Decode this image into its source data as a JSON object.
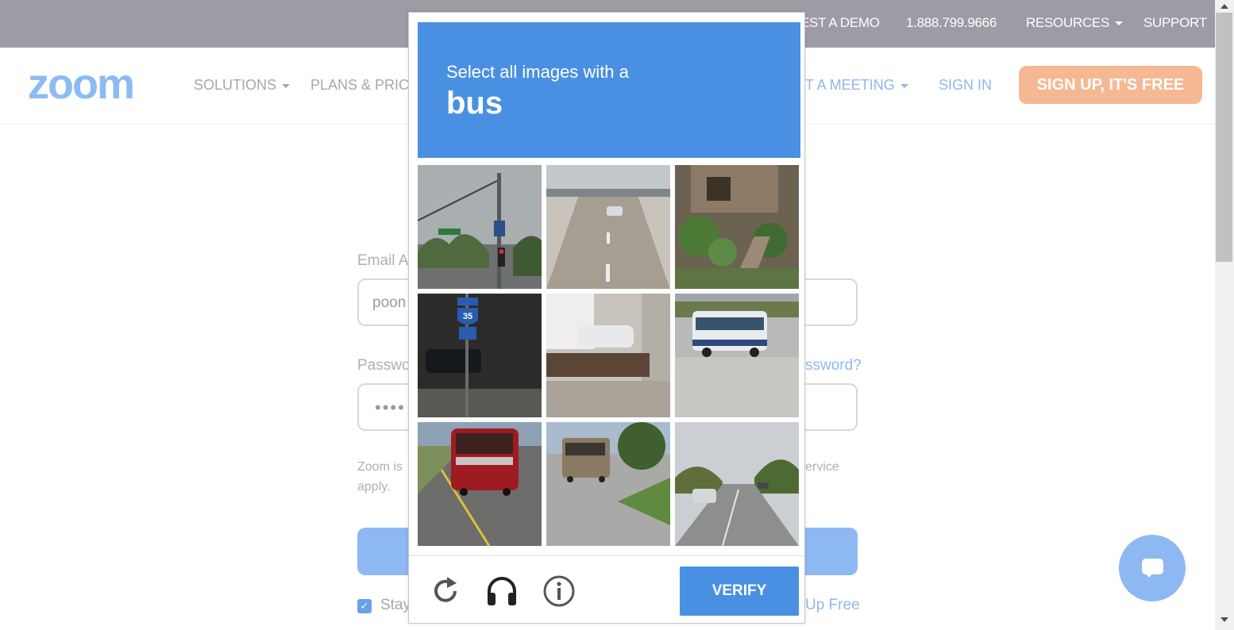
{
  "topbar": {
    "items": [
      "EST A DEMO",
      "1.888.799.9666",
      "RESOURCES",
      "SUPPORT"
    ]
  },
  "header": {
    "logo": "zoom",
    "nav": [
      "SOLUTIONS",
      "PLANS & PRICI",
      "T A MEETING",
      "SIGN IN"
    ],
    "signup": "SIGN UP, IT'S FREE"
  },
  "form": {
    "email_label": "Email A",
    "email_value": "poon",
    "password_label": "Passwo",
    "forgot_link": "ssword?",
    "password_mask": "••••",
    "terms_line1_left": "Zoom is",
    "terms_line1_right": "ervice",
    "terms_line2": "apply.",
    "stay_label": "Stay",
    "signup_link": "Up Free"
  },
  "captcha": {
    "instruction": "Select all images with a",
    "target": "bus",
    "tiles": [
      "street corner with traffic light",
      "bridge road with car",
      "house with garden stairs",
      "highway sign 35 and parked car",
      "building with white car",
      "city bus on street",
      "red coach bus on road",
      "motorhome in parking lot",
      "street with cars"
    ],
    "icons": [
      "refresh-icon",
      "audio-challenge-icon",
      "info-icon"
    ],
    "verify": "VERIFY"
  },
  "colors": {
    "captcha_blue": "#4a90e2",
    "signup_orange": "#f6b893",
    "zoom_blue": "#8bbbf5",
    "overlay_gray": "#9b9ca4"
  }
}
